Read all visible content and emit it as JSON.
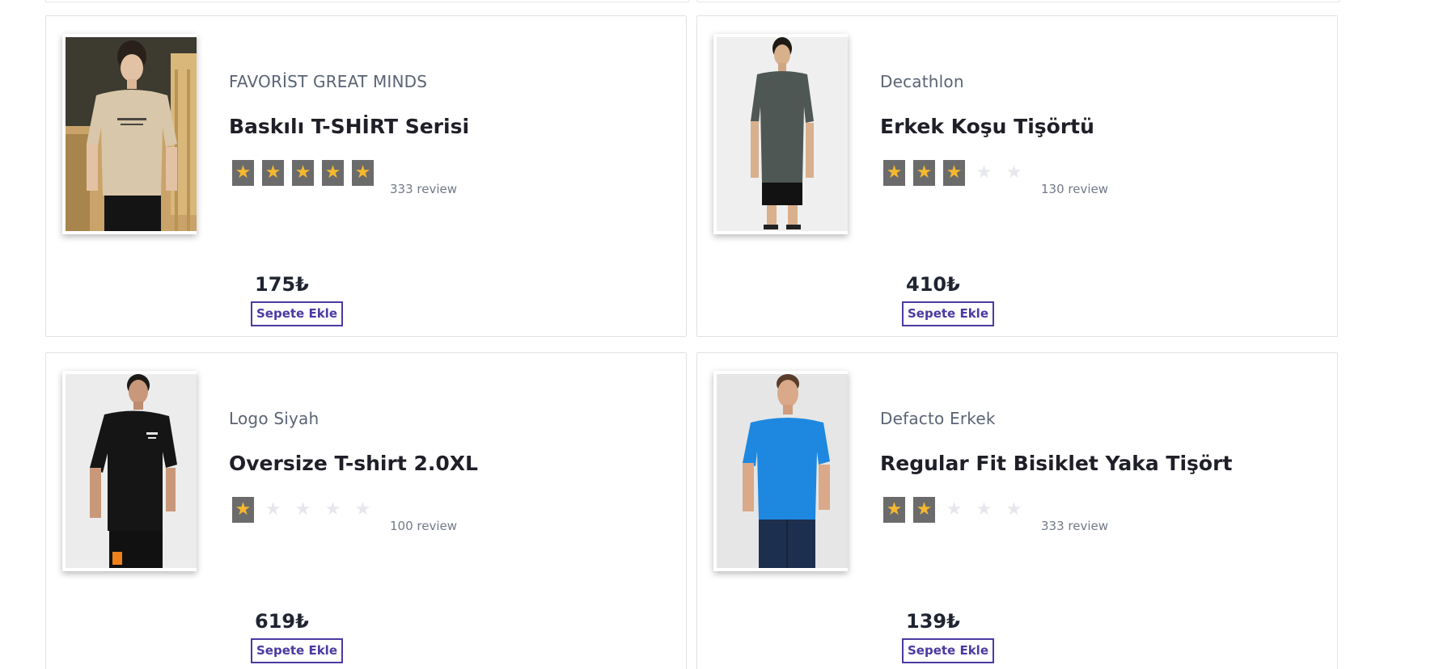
{
  "currency_symbol": "₺",
  "cart_button_label": "Sepete Ekle",
  "review_suffix": "review",
  "colors": {
    "accent": "#4b3aa1",
    "star_filled": "#f5b82e",
    "star_bg": "#6b6b6b",
    "star_empty": "#e7e8ee"
  },
  "products": [
    {
      "brand": "FAVORİST GREAT MINDS",
      "title": "Baskılı T-SHİRT Serisi",
      "rating": 5,
      "reviews": "333 review",
      "price": "175₺",
      "image": "beige-oversize-tshirt-photo"
    },
    {
      "brand": "Decathlon",
      "title": "Erkek Koşu Tişörtü",
      "rating": 3,
      "reviews": "130 review",
      "price": "410₺",
      "image": "dark-grey-running-tshirt-photo"
    },
    {
      "brand": "Logo Siyah",
      "title": "Oversize T-shirt 2.0XL",
      "rating": 1,
      "reviews": "100 review",
      "price": "619₺",
      "image": "black-oversize-tshirt-photo"
    },
    {
      "brand": "Defacto Erkek",
      "title": "Regular Fit Bisiklet Yaka Tişört",
      "rating": 2,
      "reviews": "333 review",
      "price": "139₺",
      "image": "blue-crew-neck-tshirt-photo"
    }
  ]
}
